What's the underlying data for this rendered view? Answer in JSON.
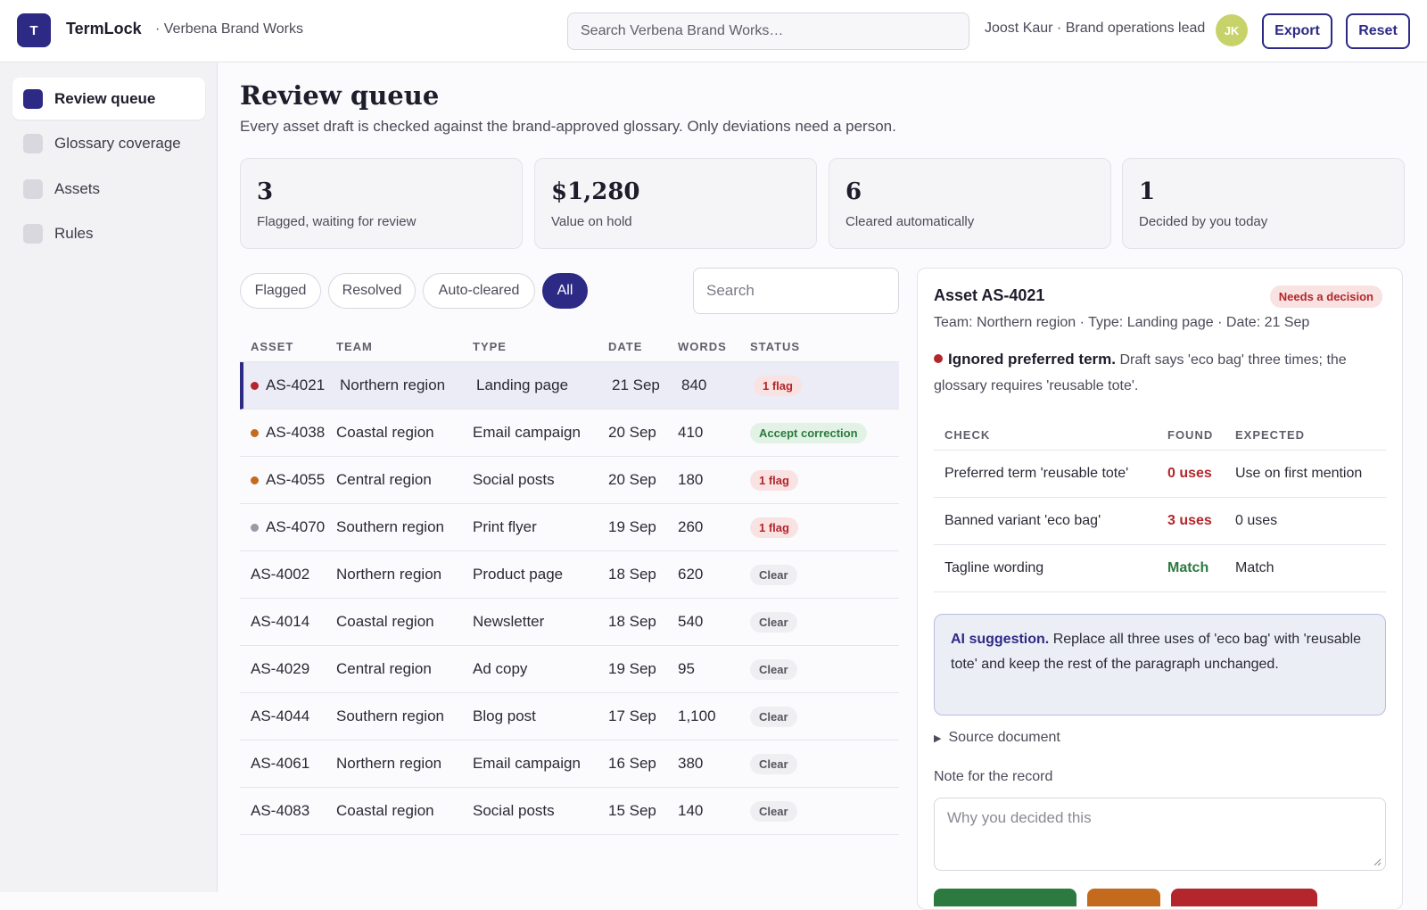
{
  "app": {
    "logo_letter": "T",
    "name": "TermLock",
    "workspace": "· Verbena Brand Works",
    "search_placeholder": "Search Verbena Brand Works…",
    "user": "Joost Kaur · Brand operations lead",
    "avatar_initials": "JK",
    "export_label": "Export",
    "reset_label": "Reset"
  },
  "sidebar": {
    "items": [
      {
        "label": "Review queue",
        "active": true
      },
      {
        "label": "Glossary coverage",
        "active": false
      },
      {
        "label": "Assets",
        "active": false
      },
      {
        "label": "Rules",
        "active": false
      }
    ]
  },
  "main": {
    "title": "Review queue",
    "subtitle": "Every asset draft is checked against the brand-approved glossary. Only deviations need a person.",
    "stats": [
      {
        "value": "3",
        "label": "Flagged, waiting for review"
      },
      {
        "value": "$1,280",
        "label": "Value on hold"
      },
      {
        "value": "6",
        "label": "Cleared automatically"
      },
      {
        "value": "1",
        "label": "Decided by you today"
      }
    ],
    "filters": [
      "Flagged",
      "Resolved",
      "Auto-cleared",
      "All"
    ],
    "active_filter": "All",
    "search_placeholder": "Search"
  },
  "table": {
    "columns": [
      "ASSET",
      "TEAM",
      "TYPE",
      "DATE",
      "WORDS",
      "STATUS"
    ],
    "rows": [
      {
        "asset": "AS-4021",
        "team": "Northern region",
        "type": "Landing page",
        "date": "21 Sep",
        "words": "840",
        "status": "1 flag",
        "status_kind": "flag",
        "dot": "#b3262b",
        "selected": true
      },
      {
        "asset": "AS-4038",
        "team": "Coastal region",
        "type": "Email campaign",
        "date": "20 Sep",
        "words": "410",
        "status": "Accept correction",
        "status_kind": "accept",
        "dot": "#c46a1e",
        "selected": false
      },
      {
        "asset": "AS-4055",
        "team": "Central region",
        "type": "Social posts",
        "date": "20 Sep",
        "words": "180",
        "status": "1 flag",
        "status_kind": "flag",
        "dot": "#c46a1e",
        "selected": false
      },
      {
        "asset": "AS-4070",
        "team": "Southern region",
        "type": "Print flyer",
        "date": "19 Sep",
        "words": "260",
        "status": "1 flag",
        "status_kind": "flag",
        "dot": "#9a9aa6",
        "selected": false
      },
      {
        "asset": "AS-4002",
        "team": "Northern region",
        "type": "Product page",
        "date": "18 Sep",
        "words": "620",
        "status": "Clear",
        "status_kind": "clear",
        "dot": "",
        "selected": false
      },
      {
        "asset": "AS-4014",
        "team": "Coastal region",
        "type": "Newsletter",
        "date": "18 Sep",
        "words": "540",
        "status": "Clear",
        "status_kind": "clear",
        "dot": "",
        "selected": false
      },
      {
        "asset": "AS-4029",
        "team": "Central region",
        "type": "Ad copy",
        "date": "19 Sep",
        "words": "95",
        "status": "Clear",
        "status_kind": "clear",
        "dot": "",
        "selected": false
      },
      {
        "asset": "AS-4044",
        "team": "Southern region",
        "type": "Blog post",
        "date": "17 Sep",
        "words": "1,100",
        "status": "Clear",
        "status_kind": "clear",
        "dot": "",
        "selected": false
      },
      {
        "asset": "AS-4061",
        "team": "Northern region",
        "type": "Email campaign",
        "date": "16 Sep",
        "words": "380",
        "status": "Clear",
        "status_kind": "clear",
        "dot": "",
        "selected": false
      },
      {
        "asset": "AS-4083",
        "team": "Coastal region",
        "type": "Social posts",
        "date": "15 Sep",
        "words": "140",
        "status": "Clear",
        "status_kind": "clear",
        "dot": "",
        "selected": false
      }
    ]
  },
  "detail": {
    "title": "Asset AS-4021",
    "badge": "Needs a decision",
    "meta": "Team: Northern region · Type: Landing page · Date: 21 Sep",
    "issue_title": "Ignored preferred term.",
    "issue_text": "Draft says 'eco bag' three times; the glossary requires 'reusable tote'.",
    "check_columns": [
      "CHECK",
      "FOUND",
      "EXPECTED"
    ],
    "checks": [
      {
        "check": "Preferred term 'reusable tote'",
        "found": "0 uses",
        "found_kind": "red",
        "expected": "Use on first mention"
      },
      {
        "check": "Banned variant 'eco bag'",
        "found": "3 uses",
        "found_kind": "red",
        "expected": "0 uses"
      },
      {
        "check": "Tagline wording",
        "found": "Match",
        "found_kind": "green",
        "expected": "Match"
      }
    ],
    "ai_label": "AI suggestion.",
    "ai_text": "Replace all three uses of 'eco bag' with 'reusable tote' and keep the rest of the paragraph unchanged.",
    "source_label": "Source document",
    "note_label": "Note for the record",
    "note_placeholder": "Why you decided this",
    "action_colors": [
      "#2c7a3f",
      "#c46a1e",
      "#b3262b"
    ]
  }
}
